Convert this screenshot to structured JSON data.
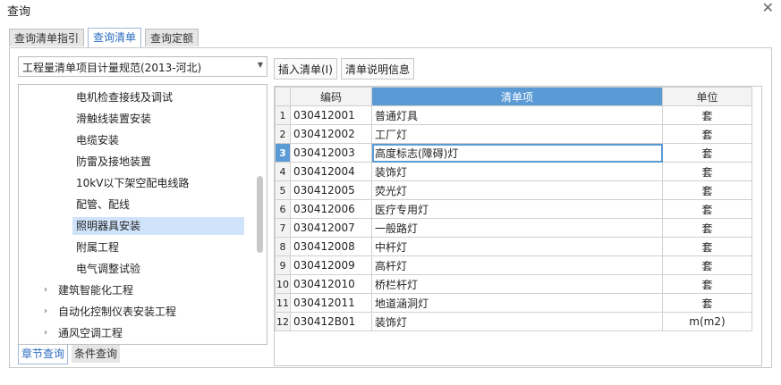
{
  "window": {
    "title": "查询",
    "close_glyph": "✕"
  },
  "top_tabs": [
    "查询清单指引",
    "查询清单",
    "查询定额"
  ],
  "standard_select": {
    "value": "工程量清单项目计量规范(2013-河北)",
    "arrow": "▼"
  },
  "tree": {
    "items": [
      {
        "label": "电机检查接线及调试",
        "level": 2,
        "selected": false
      },
      {
        "label": "滑触线装置安装",
        "level": 2,
        "selected": false
      },
      {
        "label": "电缆安装",
        "level": 2,
        "selected": false
      },
      {
        "label": "防雷及接地装置",
        "level": 2,
        "selected": false
      },
      {
        "label": "10kV以下架空配电线路",
        "level": 2,
        "selected": false
      },
      {
        "label": "配管、配线",
        "level": 2,
        "selected": false
      },
      {
        "label": "照明器具安装",
        "level": 2,
        "selected": true
      },
      {
        "label": "附属工程",
        "level": 2,
        "selected": false
      },
      {
        "label": "电气调整试验",
        "level": 2,
        "selected": false
      },
      {
        "label": "建筑智能化工程",
        "level": 1,
        "selected": false,
        "expander": "›"
      },
      {
        "label": "自动化控制仪表安装工程",
        "level": 1,
        "selected": false,
        "expander": "›"
      },
      {
        "label": "通风空调工程",
        "level": 1,
        "selected": false,
        "expander": "›"
      }
    ]
  },
  "bottom_tabs": [
    "章节查询",
    "条件查询"
  ],
  "buttons": {
    "insert": "插入清单(I)",
    "info": "清单说明信息"
  },
  "table": {
    "headers": [
      "编码",
      "清单项",
      "单位"
    ],
    "current_row": 3,
    "rows": [
      {
        "n": "1",
        "code": "030412001",
        "name": "普通灯具",
        "unit": "套"
      },
      {
        "n": "2",
        "code": "030412002",
        "name": "工厂灯",
        "unit": "套"
      },
      {
        "n": "3",
        "code": "030412003",
        "name": "高度标志(障碍)灯",
        "unit": "套"
      },
      {
        "n": "4",
        "code": "030412004",
        "name": "装饰灯",
        "unit": "套"
      },
      {
        "n": "5",
        "code": "030412005",
        "name": "荧光灯",
        "unit": "套"
      },
      {
        "n": "6",
        "code": "030412006",
        "name": "医疗专用灯",
        "unit": "套"
      },
      {
        "n": "7",
        "code": "030412007",
        "name": "一般路灯",
        "unit": "套"
      },
      {
        "n": "8",
        "code": "030412008",
        "name": "中杆灯",
        "unit": "套"
      },
      {
        "n": "9",
        "code": "030412009",
        "name": "高杆灯",
        "unit": "套"
      },
      {
        "n": "10",
        "code": "030412010",
        "name": "桥栏杆灯",
        "unit": "套"
      },
      {
        "n": "11",
        "code": "030412011",
        "name": "地道涵洞灯",
        "unit": "套"
      },
      {
        "n": "12",
        "code": "030412B01",
        "name": "装饰灯",
        "unit": "m(m2)"
      }
    ]
  }
}
